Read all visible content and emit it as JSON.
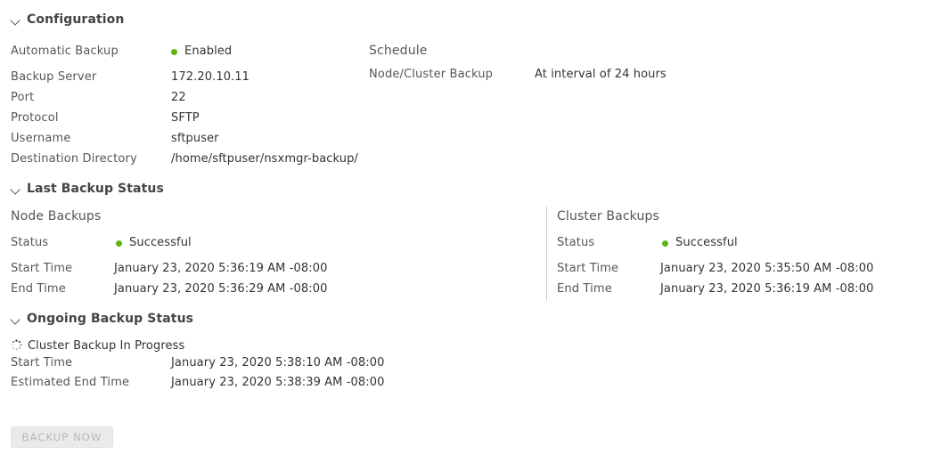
{
  "colors": {
    "status_green": "#60b515",
    "label_gray": "#565656",
    "value_dark": "#333333",
    "divider": "#cccccc",
    "button_disabled_bg": "#eaeaec",
    "button_disabled_text": "#b8b8bd"
  },
  "configuration": {
    "header": "Configuration",
    "rows": [
      {
        "label": "Automatic Backup",
        "value": "Enabled",
        "has_dot": true
      },
      {
        "label": "Backup Server",
        "value": "172.20.10.11",
        "has_dot": false
      },
      {
        "label": "Port",
        "value": "22",
        "has_dot": false
      },
      {
        "label": "Protocol",
        "value": "SFTP",
        "has_dot": false
      },
      {
        "label": "Username",
        "value": "sftpuser",
        "has_dot": false
      },
      {
        "label": "Destination Directory",
        "value": "/home/sftpuser/nsxmgr-backup/",
        "has_dot": false
      }
    ],
    "schedule": {
      "title": "Schedule",
      "rows": [
        {
          "label": "Node/Cluster Backup",
          "value": "At interval of 24 hours"
        }
      ]
    }
  },
  "last_backup_status": {
    "header": "Last Backup Status",
    "node_backups": {
      "title": "Node Backups",
      "rows": [
        {
          "label": "Status",
          "value": "Successful",
          "has_dot": true
        },
        {
          "label": "Start Time",
          "value": "January 23, 2020 5:36:19 AM -08:00",
          "has_dot": false
        },
        {
          "label": "End Time",
          "value": "January 23, 2020 5:36:29 AM -08:00",
          "has_dot": false
        }
      ]
    },
    "cluster_backups": {
      "title": "Cluster Backups",
      "rows": [
        {
          "label": "Status",
          "value": "Successful",
          "has_dot": true
        },
        {
          "label": "Start Time",
          "value": "January 23, 2020 5:35:50 AM -08:00",
          "has_dot": false
        },
        {
          "label": "End Time",
          "value": "January 23, 2020 5:36:19 AM -08:00",
          "has_dot": false
        }
      ]
    }
  },
  "ongoing_backup_status": {
    "header": "Ongoing Backup Status",
    "progress_title": "Cluster Backup In Progress",
    "spinner_icon": "loading-spinner-icon",
    "rows": [
      {
        "label": "Start Time",
        "value": "January 23, 2020 5:38:10 AM -08:00"
      },
      {
        "label": "Estimated End Time",
        "value": "January 23, 2020 5:38:39 AM -08:00"
      }
    ]
  },
  "actions": {
    "backup_now_label": "Backup Now",
    "backup_now_disabled": true
  }
}
